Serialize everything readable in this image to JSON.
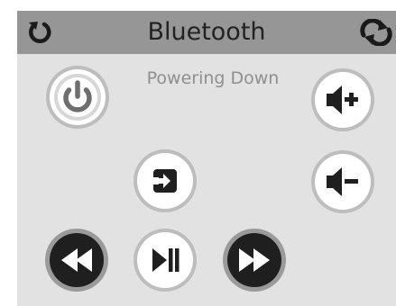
{
  "header": {
    "title": "Bluetooth",
    "left_icon": "rotate-icon",
    "right_icon": "sync-icon"
  },
  "status": {
    "text": "Powering Down"
  },
  "buttons": [
    {
      "name": "power-button",
      "icon": "power-icon"
    },
    {
      "name": "volume-up-button",
      "icon": "volume-up-icon"
    },
    {
      "name": "input-source-button",
      "icon": "input-icon"
    },
    {
      "name": "volume-down-button",
      "icon": "volume-down-icon"
    },
    {
      "name": "rewind-button",
      "icon": "rewind-icon"
    },
    {
      "name": "play-pause-button",
      "icon": "play-pause-icon"
    },
    {
      "name": "fast-forward-button",
      "icon": "fast-forward-icon"
    }
  ],
  "colors": {
    "header_bg": "#969696",
    "panel_bg": "#e2e2e2",
    "status_text": "#8f8f8f",
    "icon_dark": "#1f1f1f",
    "power_icon": "#6e6e6e"
  }
}
